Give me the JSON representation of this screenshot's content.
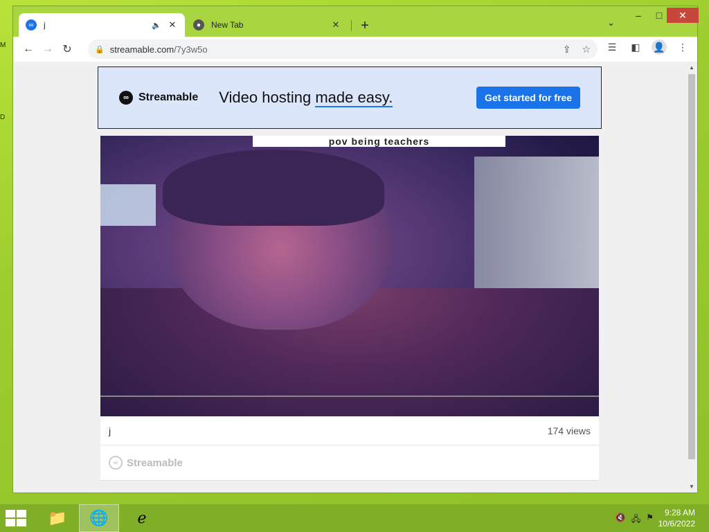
{
  "browser": {
    "tabs": [
      {
        "title": "j",
        "active": true
      },
      {
        "title": "New Tab",
        "active": false
      }
    ],
    "url": {
      "host": "streamable.com",
      "path": "/7y3w5o"
    }
  },
  "ad_banner": {
    "logo_text": "Streamable",
    "headline_prefix": "Video hosting ",
    "headline_underlined": "made easy.",
    "cta": "Get started for free"
  },
  "video": {
    "caption": "pov being teachers",
    "title": "j",
    "views": "174 views",
    "footer_brand": "Streamable"
  },
  "taskbar": {
    "time": "9:28 AM",
    "date": "10/6/2022"
  },
  "desktop": {
    "icon_fragments": [
      "M",
      "D"
    ]
  }
}
